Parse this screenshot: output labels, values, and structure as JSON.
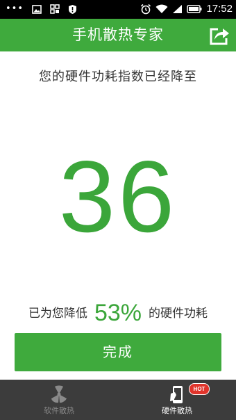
{
  "status_bar": {
    "dots": "•••",
    "time": "17:52",
    "icons": [
      "image-icon",
      "app-grid-icon",
      "shield-icon",
      "alarm-icon",
      "wifi-icon",
      "signal-icon",
      "battery-icon"
    ]
  },
  "header": {
    "title": "手机散热专家",
    "share_icon": "share-icon"
  },
  "main": {
    "headline": "您的硬件功耗指数已经降至",
    "score": "36",
    "result_prefix": "已为您降低",
    "result_percent": "53%",
    "result_suffix": "的硬件功耗",
    "done_button": "完成"
  },
  "bottom_nav": {
    "tabs": [
      {
        "label": "软件散热",
        "icon": "fan-icon",
        "active": false
      },
      {
        "label": "硬件散热",
        "icon": "phone-hand-icon",
        "active": true,
        "badge": "HOT"
      }
    ]
  },
  "colors": {
    "accent": "#3faa3d",
    "text": "#333333",
    "nav_bg": "#3c3c3c",
    "badge": "#e0342b"
  }
}
